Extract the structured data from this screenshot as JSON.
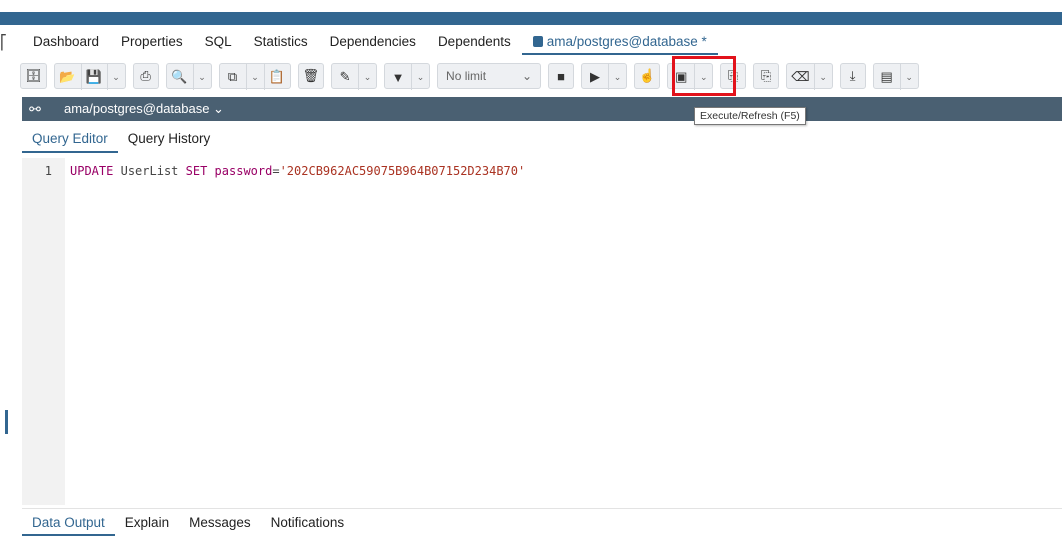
{
  "tabs": [
    {
      "label": "Dashboard"
    },
    {
      "label": "Properties"
    },
    {
      "label": "SQL"
    },
    {
      "label": "Statistics"
    },
    {
      "label": "Dependencies"
    },
    {
      "label": "Dependents"
    },
    {
      "label": "ama/postgres@database *"
    }
  ],
  "toolbar": {
    "limit_label": "No limit",
    "execute_tooltip": "Execute/Refresh (F5)"
  },
  "connection": {
    "label": "ama/postgres@database ⌄"
  },
  "subtabs": [
    {
      "label": "Query Editor"
    },
    {
      "label": "Query History"
    }
  ],
  "editor": {
    "line_number": "1",
    "code": {
      "kw_update": "UPDATE",
      "table": "UserList",
      "kw_set": "SET",
      "column": "password",
      "equals": "=",
      "value": "'202CB962AC59075B964B07152D234B70'"
    }
  },
  "bottom_tabs": [
    {
      "label": "Data Output"
    },
    {
      "label": "Explain"
    },
    {
      "label": "Messages"
    },
    {
      "label": "Notifications"
    }
  ],
  "colors": {
    "brand": "#326690",
    "connection_bar": "#4a6072",
    "highlight": "#e2121b"
  }
}
